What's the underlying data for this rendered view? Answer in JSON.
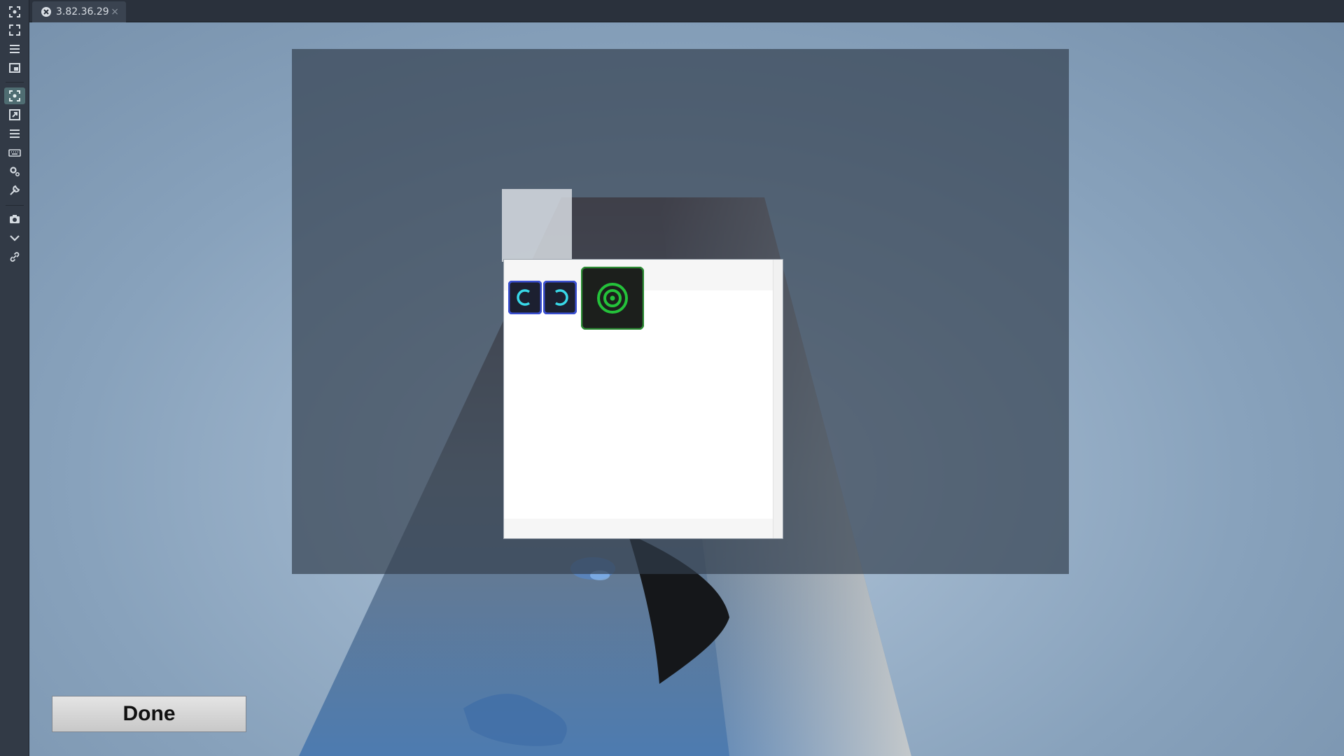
{
  "tab": {
    "label": "3.82.36.29",
    "close": "×",
    "icon": "game-controller-icon"
  },
  "toolbar": {
    "items": [
      "screenshot-frame-icon",
      "fullscreen-icon",
      "menu-icon",
      "window-icon",
      "focus-icon",
      "resize-icon",
      "list-icon",
      "keyboard-icon",
      "settings-icon",
      "wrench-icon",
      "camera-icon",
      "chevron-down-icon",
      "link-icon"
    ],
    "active": "focus-icon"
  },
  "inventory": {
    "items": [
      "blue-rune-icon",
      "blue-rune-icon",
      "green-target-icon"
    ]
  },
  "done_label": "Done",
  "colors": {
    "accent": "#4f6d72",
    "item_blue": "#3a4fd0",
    "item_green": "#24c23a"
  }
}
